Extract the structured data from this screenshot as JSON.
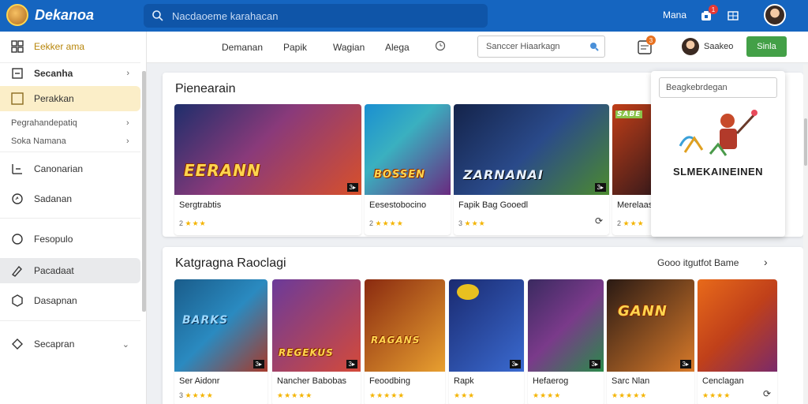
{
  "header": {
    "app_title": "Dekanoa",
    "search_placeholder": "Nacdaoeme karahacan",
    "link": "Mana",
    "notification_count": "1",
    "brand_color": "#1565c0"
  },
  "sidebar": {
    "items": [
      {
        "label": "Eekker ama",
        "icon": "grid-icon"
      },
      {
        "label": "Secanha",
        "icon": "login-icon"
      },
      {
        "label": "Perakkan",
        "icon": "square-icon"
      },
      {
        "label": "Pegrahandepatiq",
        "icon": ""
      },
      {
        "label": "Soka Namana",
        "icon": ""
      },
      {
        "label": "Canonarian",
        "icon": "chart-icon"
      },
      {
        "label": "Sadanan",
        "icon": "circle-icon"
      },
      {
        "label": "Fesopulo",
        "icon": "chat-icon"
      },
      {
        "label": "Pacadaat",
        "icon": "pencil-icon"
      },
      {
        "label": "Dasapnan",
        "icon": "hexagon-icon"
      },
      {
        "label": "Secapran",
        "icon": "diamond-icon"
      }
    ]
  },
  "tabs": {
    "items": [
      "Demanan",
      "Papik",
      "Wagian",
      "Alega"
    ],
    "search_placeholder": "Sanccer Hiaarkagn",
    "user_name": "Saakeo",
    "signup_label": "Sinla",
    "cart_count": "3",
    "accent_green": "#43a047"
  },
  "featured": {
    "title": "Pienearain",
    "games": [
      {
        "art_text": "EERANN",
        "name": "Sergtrabtis",
        "rating": "2",
        "stars": "★★★",
        "art_colors": [
          "#1e2e6b",
          "#d8502a"
        ]
      },
      {
        "art_text": "BOSSEN",
        "name": "Eesestobocino",
        "rating": "2",
        "stars": "★★★★",
        "art_colors": [
          "#1a8fd1",
          "#6a2a80"
        ]
      },
      {
        "art_text": "ZARNANAI",
        "name": "Fapik Bag Gooedl",
        "rating": "3",
        "stars": "★★★",
        "art_colors": [
          "#14234a",
          "#4c8a2f"
        ]
      },
      {
        "art_text": "SABE",
        "name": "Merelaas",
        "rating": "2",
        "stars": "★★★",
        "art_colors": [
          "#c03e18",
          "#3a1a1a"
        ]
      }
    ]
  },
  "popup": {
    "search_placeholder": "Beagkebrdegan",
    "title": "SLMEKAINEINEN"
  },
  "categories": {
    "title": "Katgragna Raoclagi",
    "link_label": "Gooo itgutfot Bame",
    "games": [
      {
        "art_text": "BARKS",
        "name": "Ser Aidonr",
        "rating": "3",
        "stars": "★★★★",
        "art_colors": [
          "#1a5c8a",
          "#a63a2a"
        ]
      },
      {
        "art_text": "REGEKUS",
        "name": "Nancher Babobas",
        "rating": "",
        "stars": "★★★★★",
        "art_colors": [
          "#6b3a9a",
          "#d44a3a"
        ]
      },
      {
        "art_text": "RAGANS",
        "name": "Feoodbing",
        "rating": "",
        "stars": "★★★★★",
        "art_colors": [
          "#8a2a10",
          "#e8a030"
        ]
      },
      {
        "art_text": "",
        "name": "Rapk",
        "rating": "",
        "stars": "★★★",
        "art_colors": [
          "#1a2a70",
          "#3a6ad0"
        ]
      },
      {
        "art_text": "",
        "name": "Hefaerog",
        "rating": "",
        "stars": "★★★★",
        "art_colors": [
          "#3a2a60",
          "#2a8a4a"
        ]
      },
      {
        "art_text": "GANN",
        "name": "Sarc Nlan",
        "rating": "",
        "stars": "★★★★★",
        "art_colors": [
          "#2a1a14",
          "#d87a2a"
        ]
      },
      {
        "art_text": "",
        "name": "Cenclagan",
        "rating": "",
        "stars": "★★★★",
        "art_colors": [
          "#e86a1a",
          "#7a2a6a"
        ]
      }
    ]
  }
}
